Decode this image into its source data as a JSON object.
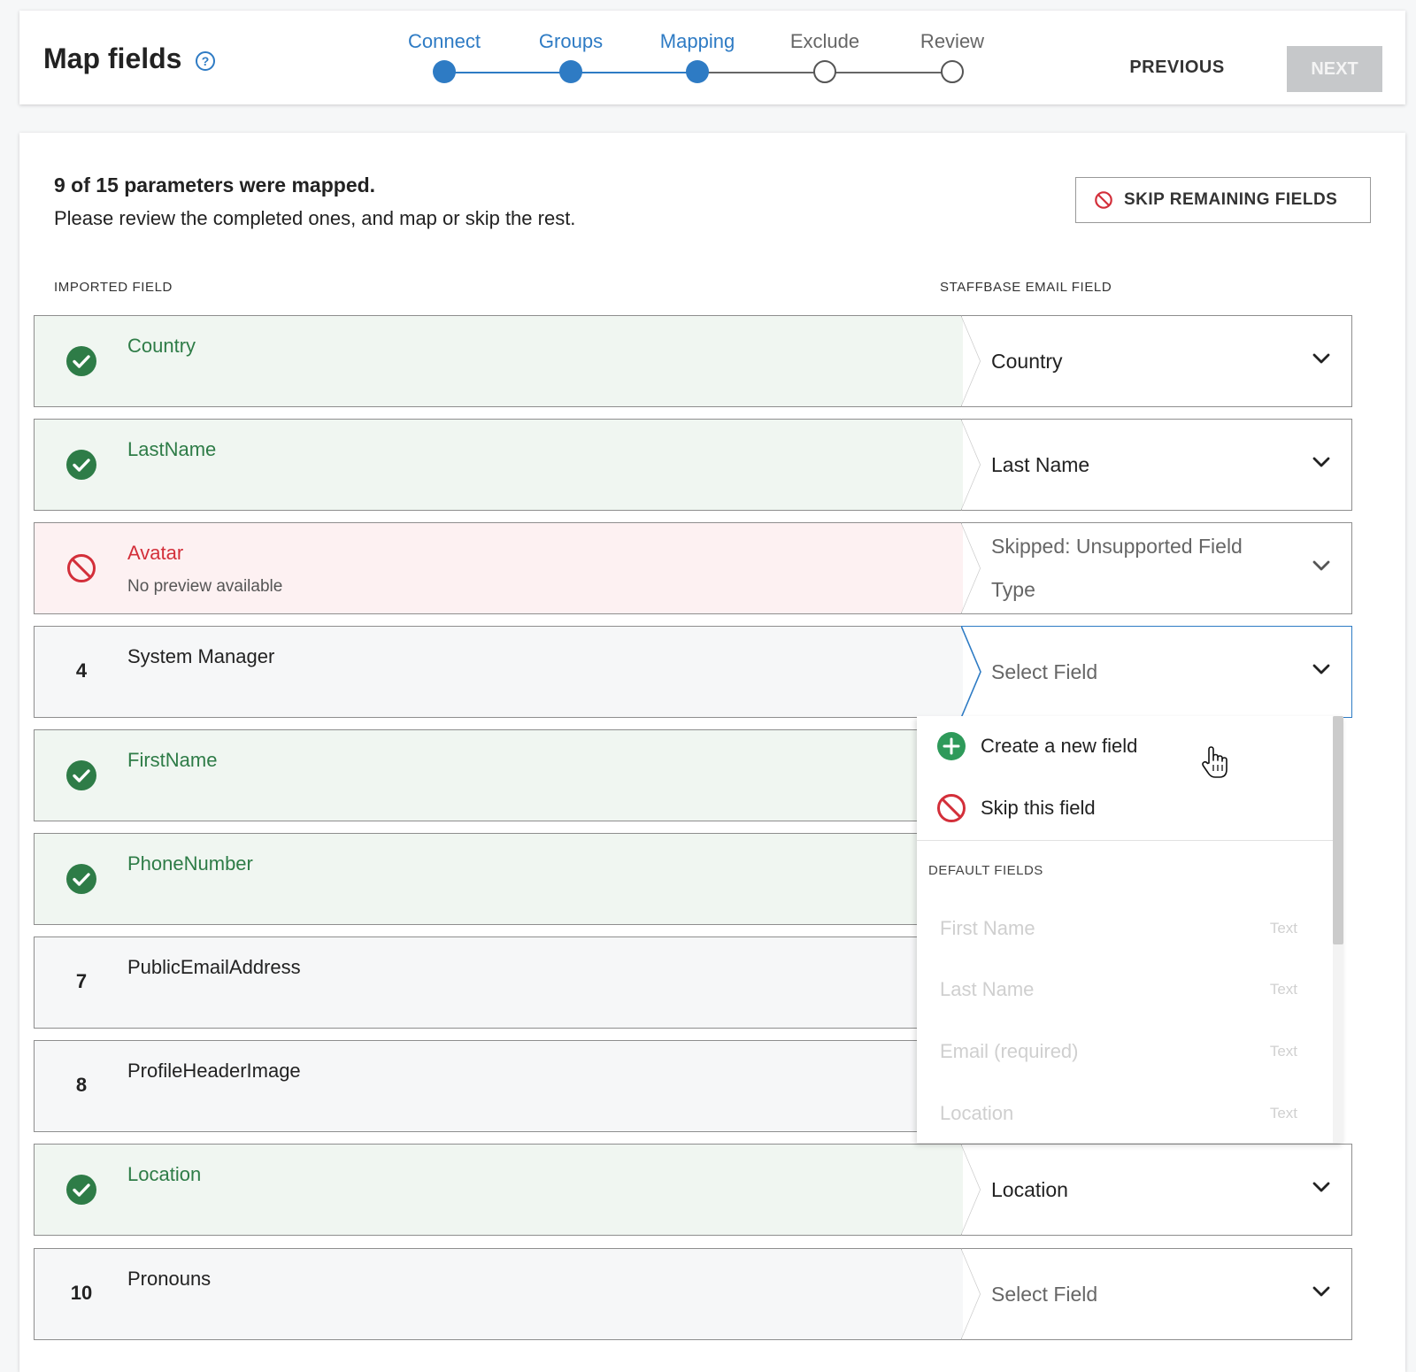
{
  "header": {
    "title": "Map fields",
    "help_icon": "help-circle-icon",
    "steps": [
      {
        "label": "Connect",
        "state": "done"
      },
      {
        "label": "Groups",
        "state": "done"
      },
      {
        "label": "Mapping",
        "state": "done"
      },
      {
        "label": "Exclude",
        "state": "todo"
      },
      {
        "label": "Review",
        "state": "todo"
      }
    ],
    "previous_label": "PREVIOUS",
    "next_label": "NEXT"
  },
  "summary": {
    "headline": "9 of 15 parameters were mapped.",
    "instructions": "Please review the completed ones, and map or skip the rest.",
    "skip_remaining_label": "SKIP REMAINING FIELDS"
  },
  "columns": {
    "imported": "IMPORTED FIELD",
    "target": "STAFFBASE EMAIL FIELD"
  },
  "rows": [
    {
      "status": "mapped",
      "number": "",
      "name": "Country",
      "subtext": "",
      "value": "Country"
    },
    {
      "status": "mapped",
      "number": "",
      "name": "LastName",
      "subtext": "",
      "value": "Last Name"
    },
    {
      "status": "skipped",
      "number": "",
      "name": "Avatar",
      "subtext": "No preview available",
      "value": "Skipped: Unsupported Field Type"
    },
    {
      "status": "unmapped",
      "number": "4",
      "name": "System Manager",
      "subtext": "",
      "value": "Select Field"
    },
    {
      "status": "mapped",
      "number": "",
      "name": "FirstName",
      "subtext": "",
      "value": ""
    },
    {
      "status": "mapped",
      "number": "",
      "name": "PhoneNumber",
      "subtext": "",
      "value": ""
    },
    {
      "status": "unmapped",
      "number": "7",
      "name": "PublicEmailAddress",
      "subtext": "",
      "value": ""
    },
    {
      "status": "unmapped",
      "number": "8",
      "name": "ProfileHeaderImage",
      "subtext": "",
      "value": ""
    },
    {
      "status": "mapped",
      "number": "",
      "name": "Location",
      "subtext": "",
      "value": "Location"
    },
    {
      "status": "unmapped",
      "number": "10",
      "name": "Pronouns",
      "subtext": "",
      "value": "Select Field"
    }
  ],
  "dropdown": {
    "create_label": "Create a new field",
    "skip_label": "Skip this field",
    "section_label": "DEFAULT FIELDS",
    "options": [
      {
        "label": "First Name",
        "type": "Text"
      },
      {
        "label": "Last Name",
        "type": "Text"
      },
      {
        "label": "Email (required)",
        "type": "Text"
      },
      {
        "label": "Location",
        "type": "Text"
      }
    ]
  },
  "colors": {
    "accent": "#2e7bc4",
    "mapped": "#2e7c47",
    "skipped": "#d32f3a"
  }
}
